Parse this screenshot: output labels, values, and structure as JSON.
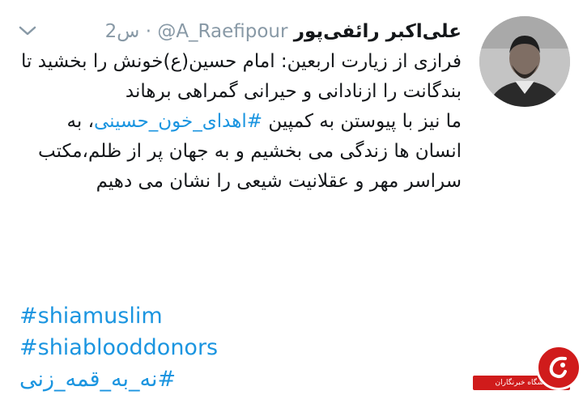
{
  "tweet": {
    "author_name": "علی‌اکبر رائفی‌پور",
    "handle": "@A_Raefipour",
    "dot": "·",
    "timestamp": "2س",
    "body_line1": "فرازی از زیارت اربعین: امام حسین(ع)خونش را بخشید تا بندگانت را ازنادانی و حیرانی گمراهی برهاند",
    "body_line2_prefix": "ما نیز با پیوستن به کمپین ",
    "body_hashtag": "#اهدای_خون_حسینی",
    "body_line2_suffix": "، به انسان ها زندگی می بخشیم و به جهان پر از ظلم،مکتب سراسر مهر و عقلانیت شیعی را نشان می دهیم",
    "hashtags": [
      "#shiamuslim",
      "#shiablooddonors",
      "#نه_به_قمه_زنی"
    ]
  },
  "watermark": {
    "text": "باشگاه خبرنگاران"
  },
  "icons": {
    "menu": "chevron-down-icon",
    "avatar": "profile-photo"
  },
  "colors": {
    "link": "#1b95e0",
    "meta": "#8899a6",
    "text": "#14171a",
    "watermark": "#d01b1b"
  }
}
